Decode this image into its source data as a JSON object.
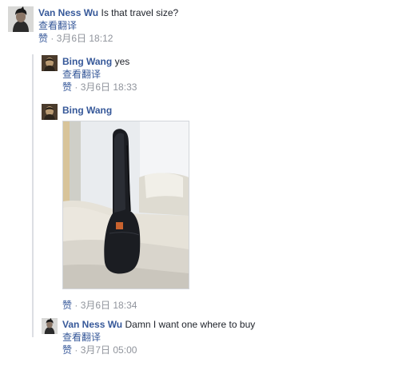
{
  "comments": [
    {
      "author": "Van Ness Wu",
      "text": "Is that travel size?",
      "translate": "查看翻译",
      "like": "赞",
      "dot": "·",
      "time": "3月6日 18:12"
    },
    {
      "author": "Bing Wang",
      "text": "yes",
      "translate": "查看翻译",
      "like": "赞",
      "dot": "·",
      "time": "3月6日 18:33"
    },
    {
      "author": "Bing Wang",
      "like": "赞",
      "dot": "·",
      "time": "3月6日 18:34"
    },
    {
      "author": "Van Ness Wu",
      "text": "Damn I want one where to buy",
      "translate": "查看翻译",
      "like": "赞",
      "dot": "·",
      "time": "3月7日 05:00"
    }
  ],
  "colors": {
    "link": "#365899",
    "meta": "#90949c",
    "text": "#1d2129",
    "thread_line": "#dcdee3"
  },
  "icons": {
    "avatar_van": "avatar-van-ness-wu",
    "avatar_bing": "avatar-bing-wang",
    "photo": "black-instrument-case-on-sofa-photo"
  }
}
